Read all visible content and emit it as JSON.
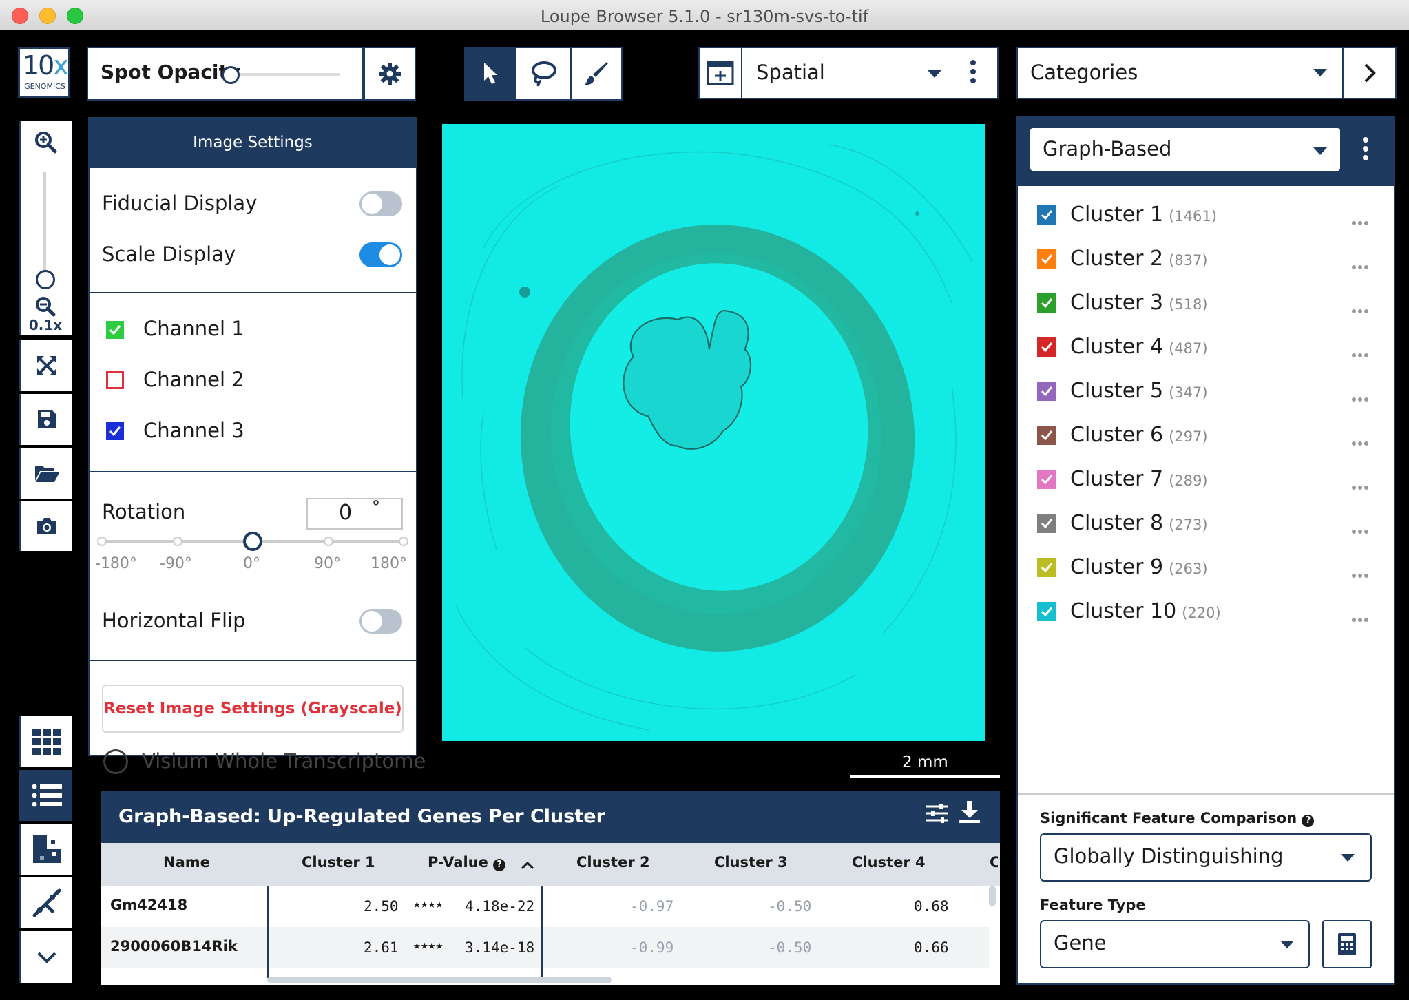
{
  "window": {
    "title": "Loupe Browser 5.1.0 - sr130m-svs-to-tif"
  },
  "logo": {
    "main": "10",
    "accent": "x",
    "sub": "GENOMICS"
  },
  "zoom": {
    "level": "0.1x"
  },
  "spot_opacity": {
    "label": "Spot Opacity",
    "value_fraction": 0.0
  },
  "image_settings": {
    "title": "Image Settings",
    "fiducial_display": {
      "label": "Fiducial Display",
      "on": false
    },
    "scale_display": {
      "label": "Scale Display",
      "on": true
    },
    "channels": [
      {
        "label": "Channel 1",
        "checked": true,
        "color": "#2ecc40"
      },
      {
        "label": "Channel 2",
        "checked": false,
        "color": "#e0323a"
      },
      {
        "label": "Channel 3",
        "checked": true,
        "color": "#1a2fd6"
      }
    ],
    "rotation": {
      "label": "Rotation",
      "value": "0",
      "unit": "°",
      "ticks": [
        "-180°",
        "-90°",
        "0°",
        "90°",
        "180°"
      ]
    },
    "horizontal_flip": {
      "label": "Horizontal Flip",
      "on": false
    },
    "reset_label": "Reset Image Settings (Grayscale)"
  },
  "visium_label": "Visium Whole Transcriptome",
  "view": {
    "selected": "Spatial"
  },
  "scale_bar": {
    "label": "2 mm"
  },
  "categories": {
    "selected": "Categories"
  },
  "clustering": {
    "selected": "Graph-Based",
    "clusters": [
      {
        "name": "Cluster 1",
        "count": "(1461)",
        "color": "#1f77b4"
      },
      {
        "name": "Cluster 2",
        "count": "(837)",
        "color": "#ff7f0e"
      },
      {
        "name": "Cluster 3",
        "count": "(518)",
        "color": "#2ca02c"
      },
      {
        "name": "Cluster 4",
        "count": "(487)",
        "color": "#d62728"
      },
      {
        "name": "Cluster 5",
        "count": "(347)",
        "color": "#9467bd"
      },
      {
        "name": "Cluster 6",
        "count": "(297)",
        "color": "#8c564b"
      },
      {
        "name": "Cluster 7",
        "count": "(289)",
        "color": "#e377c2"
      },
      {
        "name": "Cluster 8",
        "count": "(273)",
        "color": "#7f7f7f"
      },
      {
        "name": "Cluster 9",
        "count": "(263)",
        "color": "#bcbd22"
      },
      {
        "name": "Cluster 10",
        "count": "(220)",
        "color": "#17becf"
      }
    ]
  },
  "feature_comparison": {
    "label": "Significant Feature Comparison",
    "selected": "Globally Distinguishing",
    "feature_type_label": "Feature Type",
    "feature_type": "Gene"
  },
  "gene_table": {
    "title": "Graph-Based: Up-Regulated Genes Per Cluster",
    "columns": [
      "Name",
      "Cluster 1",
      "P-Value",
      "Cluster 2",
      "Cluster 3",
      "Cluster 4",
      "C"
    ],
    "rows": [
      {
        "name": "Gm42418",
        "c1": "2.50",
        "stars": "★★★★",
        "pval": "4.18e-22",
        "c2": "-0.97",
        "c3": "-0.50",
        "c4": "0.68"
      },
      {
        "name": "2900060B14Rik",
        "c1": "2.61",
        "stars": "★★★★",
        "pval": "3.14e-18",
        "c2": "-0.99",
        "c3": "-0.50",
        "c4": "0.66"
      }
    ]
  }
}
